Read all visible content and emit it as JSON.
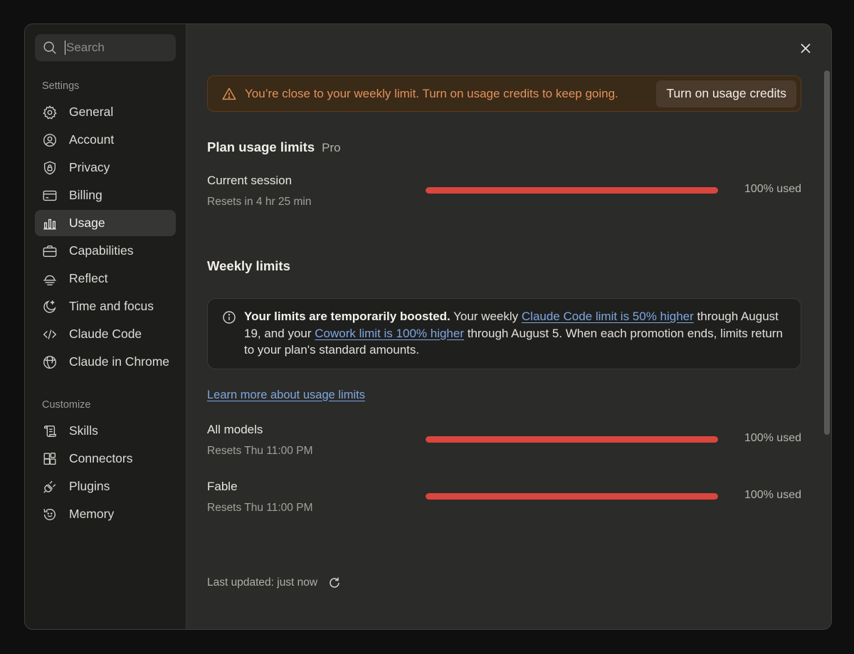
{
  "sidebar": {
    "search_placeholder": "Search",
    "section_settings": "Settings",
    "settings_items": [
      {
        "label": "General",
        "icon": "gear-icon"
      },
      {
        "label": "Account",
        "icon": "user-circle-icon"
      },
      {
        "label": "Privacy",
        "icon": "shield-lock-icon"
      },
      {
        "label": "Billing",
        "icon": "credit-card-icon"
      },
      {
        "label": "Usage",
        "icon": "bar-chart-icon",
        "active": true
      },
      {
        "label": "Capabilities",
        "icon": "briefcase-icon"
      },
      {
        "label": "Reflect",
        "icon": "horizon-icon"
      },
      {
        "label": "Time and focus",
        "icon": "moon-icon"
      },
      {
        "label": "Claude Code",
        "icon": "code-icon"
      },
      {
        "label": "Claude in Chrome",
        "icon": "globe-icon"
      }
    ],
    "section_customize": "Customize",
    "customize_items": [
      {
        "label": "Skills",
        "icon": "scroll-icon"
      },
      {
        "label": "Connectors",
        "icon": "blocks-icon"
      },
      {
        "label": "Plugins",
        "icon": "plug-icon"
      },
      {
        "label": "Memory",
        "icon": "history-icon"
      }
    ]
  },
  "banner": {
    "text": "You’re close to your weekly limit. Turn on usage credits to keep going.",
    "button_label": "Turn on usage credits",
    "color": "#e2925a"
  },
  "plan": {
    "title": "Plan usage limits",
    "tier": "Pro"
  },
  "current_session": {
    "label": "Current session",
    "reset": "Resets in 4 hr 25 min",
    "used_fraction": 1.0,
    "used_text": "100% used"
  },
  "weekly": {
    "title": "Weekly limits",
    "notice": {
      "bold": "Your limits are temporarily boosted.",
      "text1": " Your weekly ",
      "link1": "Claude Code limit is 50% higher",
      "text2": " through August 19, and your ",
      "link2": "Cowork limit is 100% higher",
      "text3": " through August 5. When each promotion ends, limits return to your plan's standard amounts."
    },
    "learn_more": "Learn more about usage limits",
    "rows": [
      {
        "label": "All models",
        "reset": "Resets Thu 11:00 PM",
        "used_fraction": 1.0,
        "used_text": "100% used"
      },
      {
        "label": "Fable",
        "reset": "Resets Thu 11:00 PM",
        "used_fraction": 1.0,
        "used_text": "100% used"
      }
    ]
  },
  "footer": {
    "last_updated": "Last updated: just now"
  },
  "colors": {
    "bar_fill": "#d9463e",
    "link": "#7fa7e0"
  }
}
